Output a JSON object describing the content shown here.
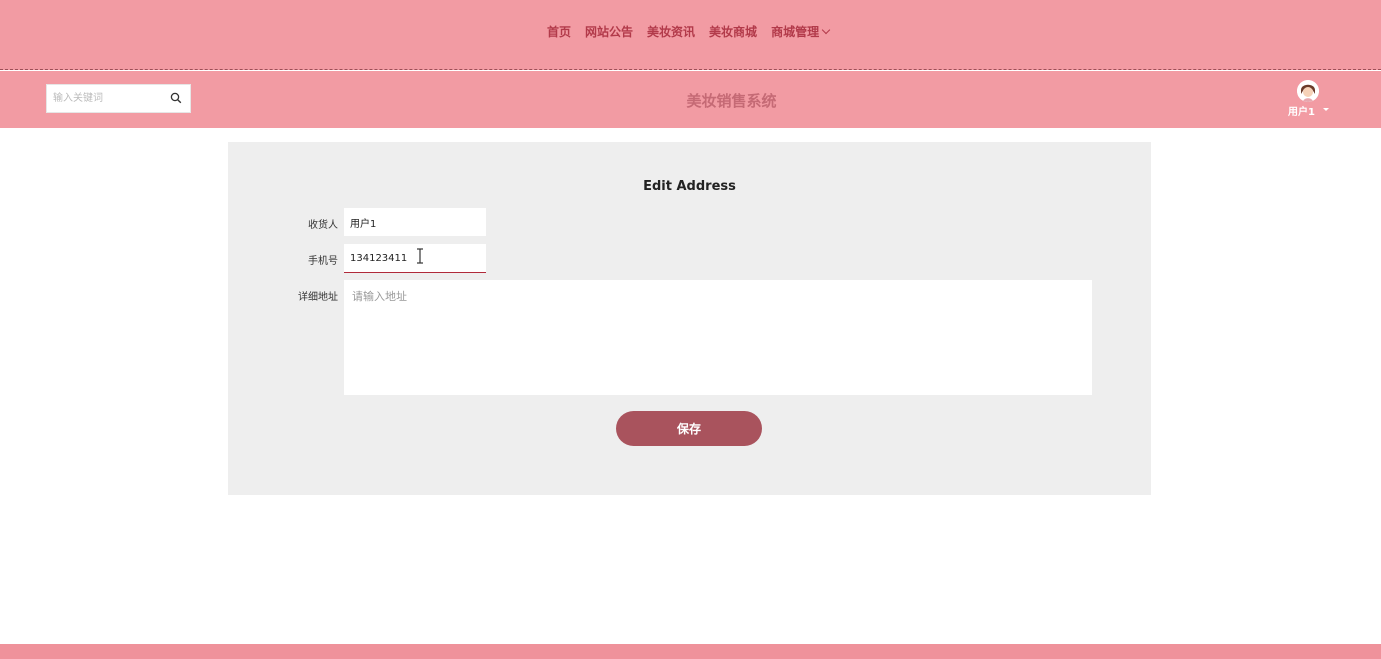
{
  "nav": {
    "items": [
      "首页",
      "网站公告",
      "美妆资讯",
      "美妆商城",
      "商城管理"
    ]
  },
  "header": {
    "search_placeholder": "输入关键词",
    "site_title": "美妆销售系统",
    "user_name": "用户1"
  },
  "form": {
    "title": "Edit Address",
    "recipient_label": "收货人",
    "recipient_value": "用户1",
    "phone_label": "手机号",
    "phone_value": "134123411",
    "address_label": "详细地址",
    "address_placeholder": "请输入地址",
    "save_label": "保存"
  },
  "colors": {
    "nav_bg": "#f29ba3",
    "accent": "#a9535d",
    "panel_bg": "#eeeeee"
  },
  "icons": {
    "search": "search-icon",
    "avatar": "avatar-icon",
    "dropdown": "chevron-down-icon"
  }
}
